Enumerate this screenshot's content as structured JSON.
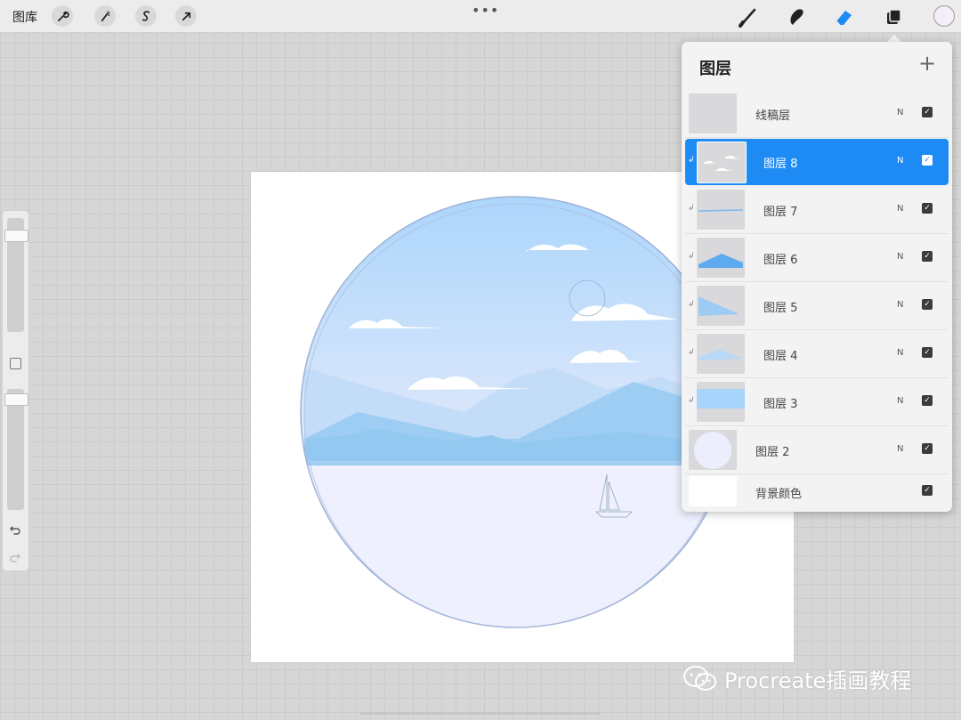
{
  "toolbar": {
    "gallery_label": "图库",
    "more_symbol": "•••",
    "left_tools": [
      "wrench-icon",
      "magic-wand-icon",
      "selection-icon",
      "transform-icon"
    ],
    "right_tools": [
      "brush-icon",
      "smudge-icon",
      "eraser-icon",
      "layers-icon"
    ],
    "active_tool": "eraser-icon",
    "accent_color": "#1e8bf5",
    "current_color": "#f4eef6"
  },
  "sidebar": {
    "brush_size_level": 0.11,
    "opacity_level": 0.04,
    "undo_icon": "undo-icon",
    "redo_icon": "redo-icon"
  },
  "layers_panel": {
    "title": "图层",
    "add_symbol": "+",
    "layers": [
      {
        "name": "线稿层",
        "mode": "N",
        "visible": true,
        "clipped": false,
        "selected": false
      },
      {
        "name": "图层 8",
        "mode": "N",
        "visible": true,
        "clipped": true,
        "selected": true
      },
      {
        "name": "图层 7",
        "mode": "N",
        "visible": true,
        "clipped": true,
        "selected": false
      },
      {
        "name": "图层 6",
        "mode": "N",
        "visible": true,
        "clipped": true,
        "selected": false
      },
      {
        "name": "图层 5",
        "mode": "N",
        "visible": true,
        "clipped": true,
        "selected": false
      },
      {
        "name": "图层 4",
        "mode": "N",
        "visible": true,
        "clipped": true,
        "selected": false
      },
      {
        "name": "图层 3",
        "mode": "N",
        "visible": true,
        "clipped": true,
        "selected": false
      },
      {
        "name": "图层 2",
        "mode": "N",
        "visible": true,
        "clipped": false,
        "selected": false
      },
      {
        "name": "背景颜色",
        "mode": "",
        "visible": true,
        "clipped": false,
        "selected": false
      }
    ]
  },
  "watermark": {
    "text": "Procreate插画教程",
    "icon": "wechat-icon"
  }
}
